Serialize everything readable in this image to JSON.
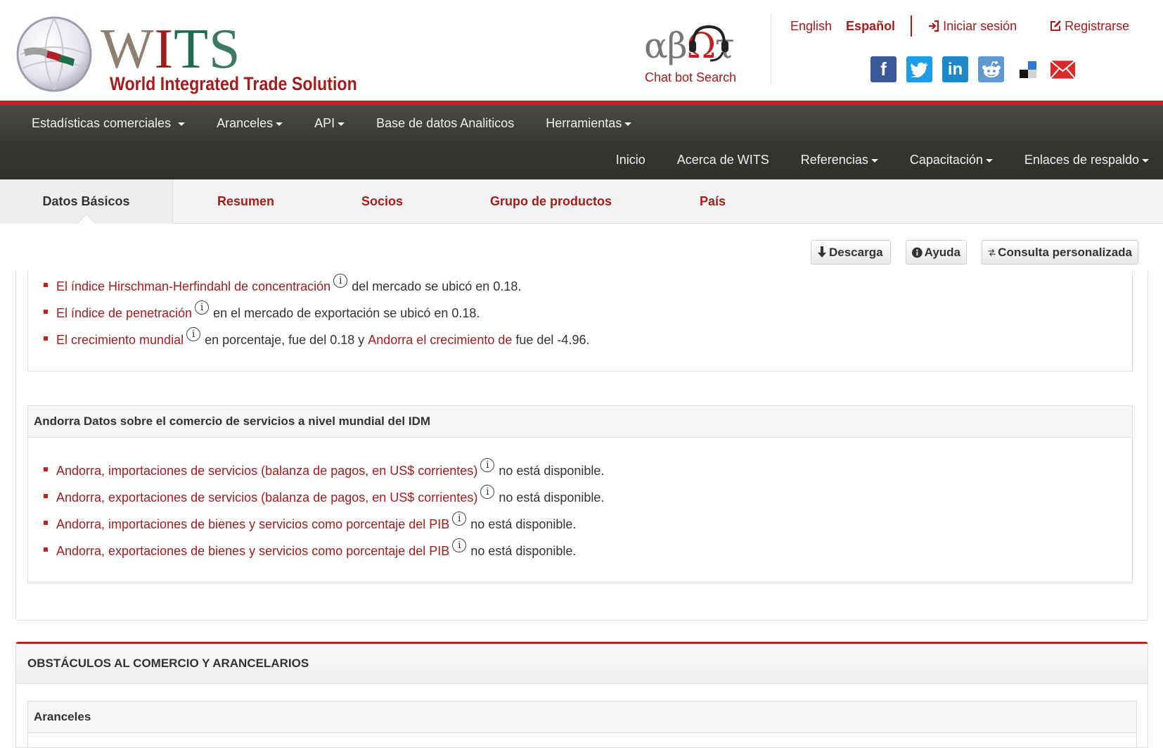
{
  "brand": {
    "logo_text": "WITS",
    "tagline": "World Integrated Trade Solution",
    "chatbot_symbol": "αβΩτ",
    "chatbot_label": "Chat bot Search"
  },
  "top_links": {
    "lang_en": "English",
    "lang_es": "Español",
    "login": "Iniciar sesión",
    "register": "Registrarse"
  },
  "social": [
    "facebook-icon",
    "twitter-icon",
    "linkedin-icon",
    "reddit-icon",
    "delicious-icon",
    "email-icon"
  ],
  "nav": {
    "row1": [
      {
        "label": "Estadísticas comerciales",
        "dropdown": true
      },
      {
        "label": "Aranceles",
        "dropdown": true
      },
      {
        "label": "API",
        "dropdown": true
      },
      {
        "label": "Base de datos Analiticos",
        "dropdown": false
      },
      {
        "label": "Herramientas",
        "dropdown": true
      }
    ],
    "row2": [
      {
        "label": "Inicio",
        "dropdown": false
      },
      {
        "label": "Acerca de WITS",
        "dropdown": false
      },
      {
        "label": "Referencias",
        "dropdown": true
      },
      {
        "label": "Capacitación",
        "dropdown": true
      },
      {
        "label": "Enlaces de respaldo",
        "dropdown": true
      }
    ]
  },
  "tabs": [
    "Datos Básicos",
    "Resumen",
    "Socios",
    "Grupo de productos",
    "País"
  ],
  "toolbar": {
    "download": "Descarga",
    "help": "Ayuda",
    "custom_query": "Consulta personalizada"
  },
  "market_bullets": [
    {
      "link": "El índice Hirschman-Herfindahl de concentración",
      "text": "del mercado se ubicó en 0.18."
    },
    {
      "link": "El índice de penetración",
      "text": "en el mercado de exportación se ubicó en 0.18."
    },
    {
      "link": "El crecimiento mundial",
      "text": "en porcentaje, fue del 0.18 y",
      "link2": "Andorra el crecimiento de",
      "text2": "fue del -4.96."
    }
  ],
  "services": {
    "title": "Andorra Datos sobre el comercio de servicios a nivel mundial del IDM",
    "items": [
      {
        "link": "Andorra, importaciones de servicios (balanza de pagos, en US$ corrientes)",
        "text": "no está disponible."
      },
      {
        "link": "Andorra, exportaciones de servicios (balanza de pagos, en US$ corrientes)",
        "text": "no está disponible."
      },
      {
        "link": "Andorra, importaciones de bienes y servicios como porcentaje del PIB",
        "text": "no está disponible."
      },
      {
        "link": "Andorra, exportaciones de bienes y servicios como porcentaje del PIB",
        "text": "no está disponible."
      }
    ]
  },
  "obstacles": {
    "title": "OBSTÁCULOS AL COMERCIO Y ARANCELARIOS",
    "subtitle": "Aranceles"
  },
  "colors": {
    "brand_red": "#a61c1c",
    "bar_red": "#c0231f",
    "nav_dark": "#353632"
  }
}
